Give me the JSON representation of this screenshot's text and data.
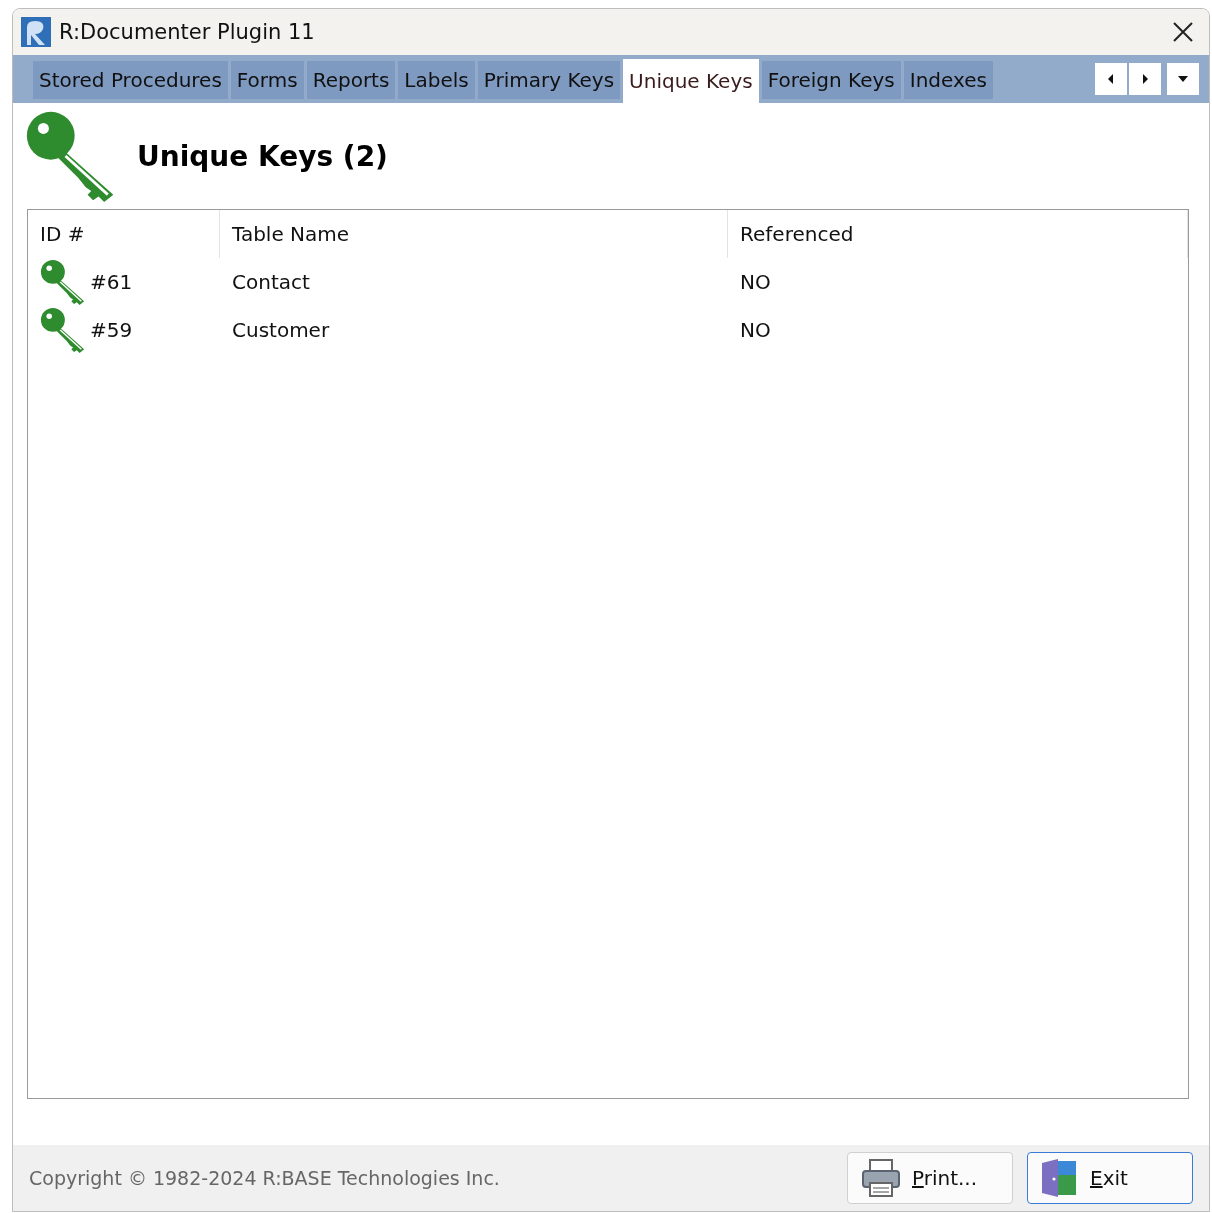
{
  "window": {
    "title": "R:Documenter Plugin 11"
  },
  "tabs": [
    {
      "label": "Stored Procedures",
      "selected": false
    },
    {
      "label": "Forms",
      "selected": false
    },
    {
      "label": "Reports",
      "selected": false
    },
    {
      "label": "Labels",
      "selected": false
    },
    {
      "label": "Primary Keys",
      "selected": false
    },
    {
      "label": "Unique Keys",
      "selected": true
    },
    {
      "label": "Foreign Keys",
      "selected": false
    },
    {
      "label": "Indexes",
      "selected": false
    }
  ],
  "heading": "Unique Keys (2)",
  "table": {
    "columns": [
      "ID #",
      "Table Name",
      "Referenced"
    ],
    "rows": [
      [
        "#61",
        "Contact",
        "NO"
      ],
      [
        "#59",
        "Customer",
        "NO"
      ]
    ]
  },
  "status_bar": {
    "copyright": "Copyright © 1982-2024 R:BASE Technologies Inc.",
    "buttons": [
      {
        "kind": "print",
        "label": "Print..."
      },
      {
        "kind": "exit",
        "label": "Exit"
      }
    ]
  }
}
